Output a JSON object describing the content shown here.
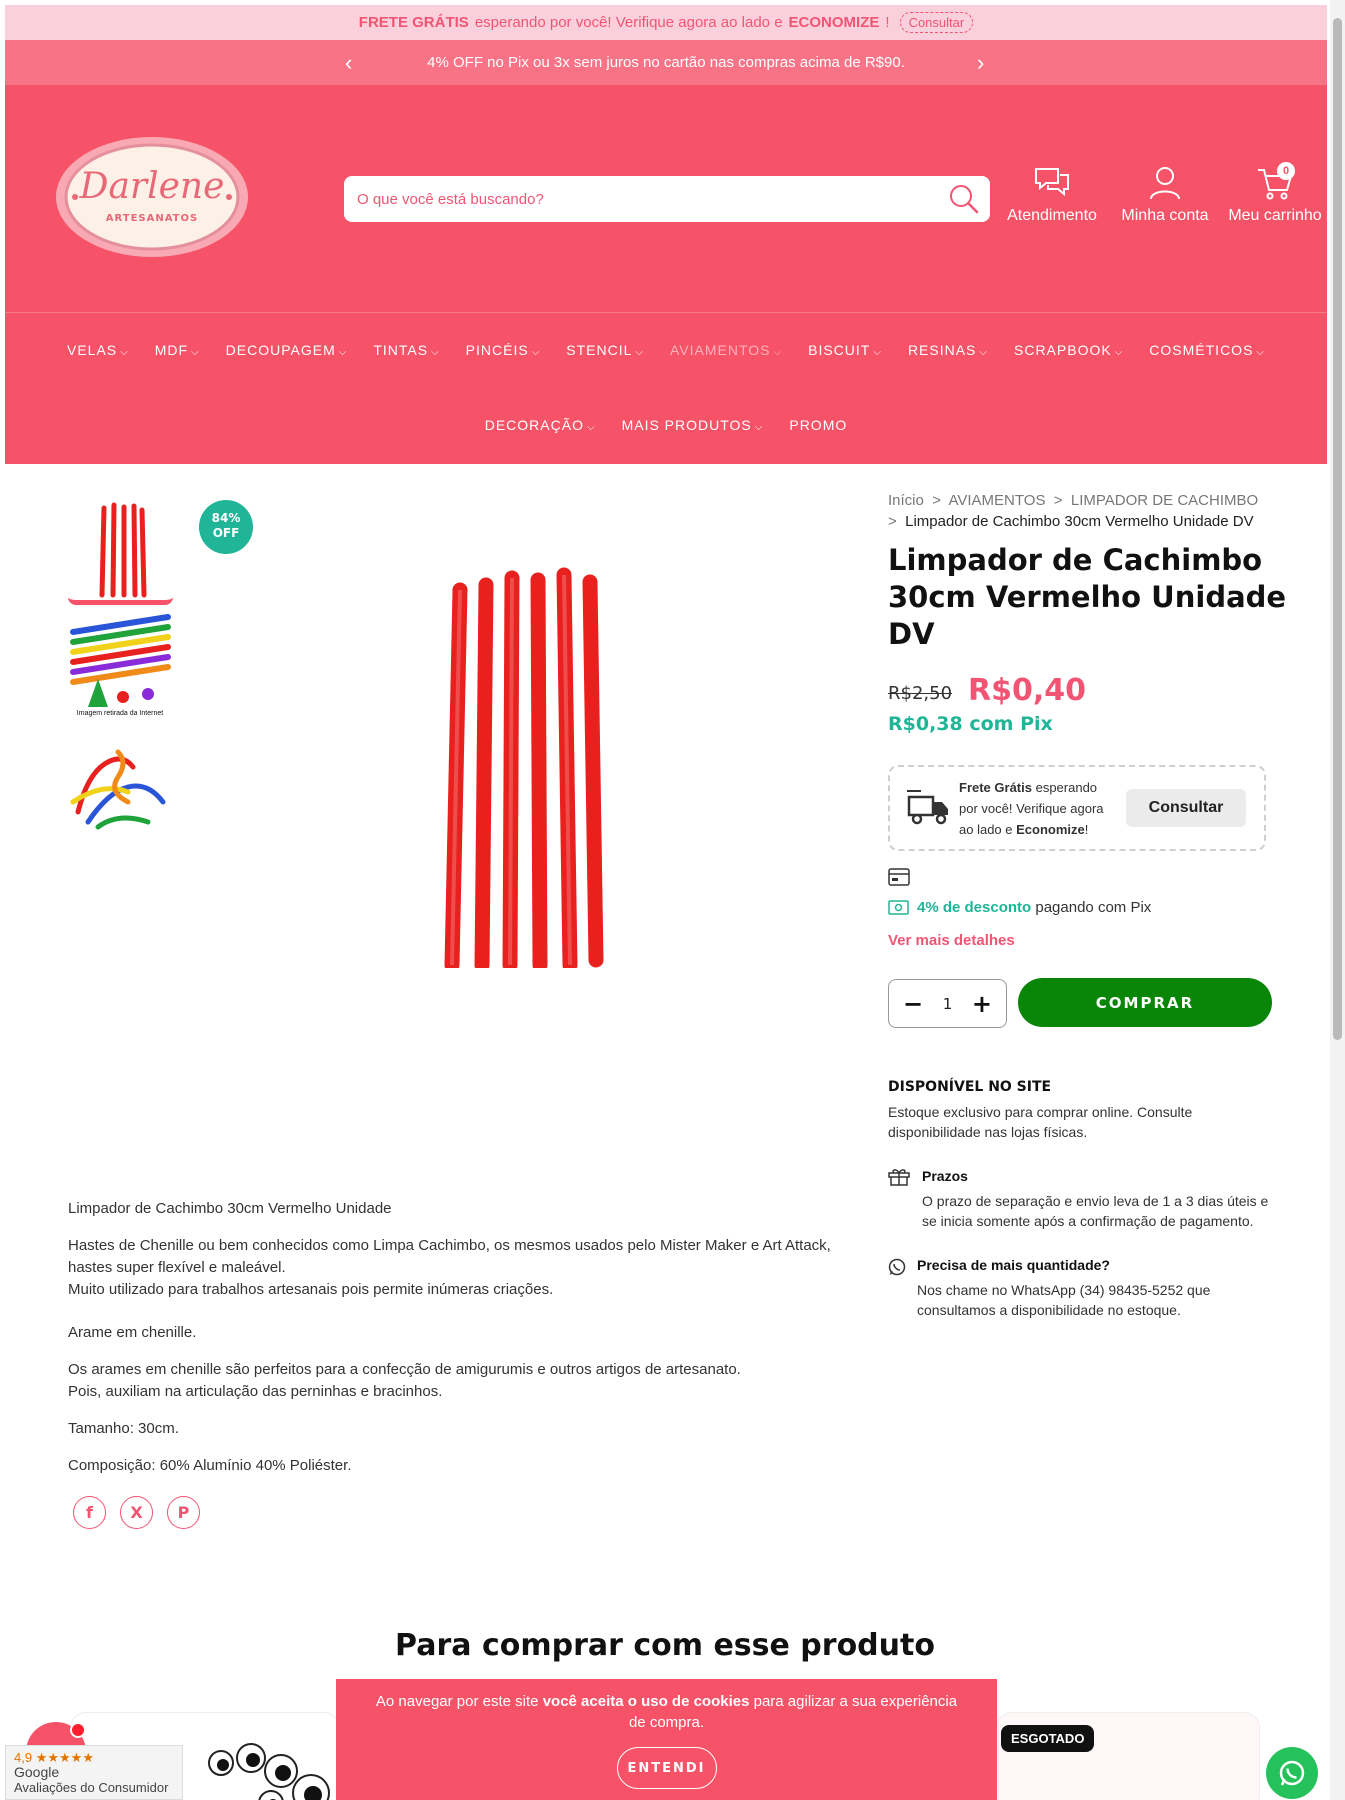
{
  "topbar": {
    "frete_label": "FRETE GRÁTIS",
    "middle_text": "esperando por você! Verifique agora ao lado e",
    "economize_label": "ECONOMIZE",
    "exclamation": "!",
    "button": "Consultar"
  },
  "promo": {
    "text": "4% OFF no Pix ou 3x sem juros no cartão nas compras acima de R$90.",
    "prev_icon": "chevron-left-icon",
    "next_icon": "chevron-right-icon"
  },
  "header": {
    "logo_name": "Darlene",
    "logo_sub": "ARTESANATOS",
    "search_placeholder": "O que você está buscando?",
    "support_label": "Atendimento",
    "account_label": "Minha conta",
    "cart_label": "Meu carrinho",
    "cart_count": "0"
  },
  "nav": {
    "row1": [
      "VELAS",
      "MDF",
      "DECOUPAGEM",
      "TINTAS",
      "PINCÉIS",
      "STENCIL",
      "AVIAMENTOS",
      "BISCUIT",
      "RESINAS",
      "SCRAPBOOK",
      "COSMÉTICOS"
    ],
    "row2": [
      "DECORAÇÃO",
      "MAIS PRODUTOS",
      "PROMO"
    ],
    "chevron": "⌵"
  },
  "gallery": {
    "discount_percent": "84%",
    "discount_label": "OFF",
    "thumb2_caption": "Imagem retirada da Internet"
  },
  "breadcrumb": {
    "sep": ">",
    "home": "Início",
    "category": "AVIAMENTOS",
    "subcategory": "LIMPADOR DE CACHIMBO",
    "current": "Limpador de Cachimbo 30cm Vermelho Unidade DV"
  },
  "product": {
    "title": "Limpador de Cachimbo 30cm Vermelho Unidade DV",
    "old_price": "R$2,50",
    "price": "R$0,40",
    "pix_price": "R$0,38 com Pix",
    "frete": {
      "bold1": "Frete Grátis",
      "text1": " esperando por você! Verifique agora ao lado e ",
      "bold2": "Economize",
      "text2": "!",
      "button": "Consultar"
    },
    "pix_discount": "4% de desconto",
    "pix_suffix": "pagando com Pix",
    "more_details": "Ver mais detalhes",
    "quantity": "1",
    "buy_button": "COMPRAR",
    "stock_title": "DISPONÍVEL NO SITE",
    "stock_text": "Estoque exclusivo para comprar online. Consulte disponibilidade nas lojas físicas.",
    "prazos_title": "Prazos",
    "prazos_text": "O prazo de separação e envio leva de 1 a 3 dias úteis e se inicia somente após a confirmação de pagamento.",
    "qty_title": "Precisa de mais quantidade?",
    "qty_text": "Nos chame no WhatsApp (34) 98435-5252 que consultamos a disponibilidade no estoque."
  },
  "description": {
    "p1": "Limpador de Cachimbo 30cm Vermelho Unidade",
    "p2a": "Hastes de Chenille ou bem conhecidos como Limpa Cachimbo, os mesmos usados pelo Mister Maker e Art Attack, hastes super flexível e maleável.",
    "p2b": "Muito utilizado para trabalhos artesanais pois permite inúmeras criações.",
    "p3": "Arame em chenille.",
    "p4a": "Os arames em chenille são perfeitos para a confecção de amigurumis e outros artigos de artesanato.",
    "p4b": "Pois, auxiliam na articulação das perninhas e bracinhos.",
    "p5": "Tamanho: 30cm.",
    "p6": "Composição: 60% Alumínio 40% Poliéster."
  },
  "social": {
    "facebook": "f",
    "x": "X",
    "pinterest": "P"
  },
  "related": {
    "title": "Para comprar com esse produto",
    "sold_out": "ESGOTADO"
  },
  "cookie": {
    "text1": "Ao navegar por este site ",
    "bold": "você aceita o uso de cookies",
    "text2": " para agilizar a sua experiência de compra.",
    "button": "ENTENDI"
  },
  "google": {
    "rating": "4,9",
    "stars": "★★★★★",
    "brand": "Google",
    "label": "Avaliações do Consumidor"
  },
  "colors": {
    "brand": "#f65368",
    "accent_pink": "#f25573",
    "teal": "#20b597",
    "buy_green": "#098608"
  }
}
